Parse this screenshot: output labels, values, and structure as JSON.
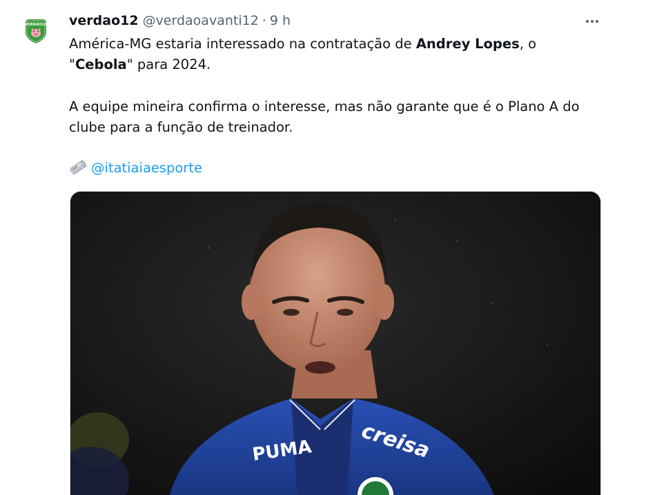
{
  "tweet": {
    "avatar_text": "VERDÃO12",
    "author_name": "verdao12",
    "author_handle": "@verdaoavanti12",
    "separator": "·",
    "timestamp": "9 h",
    "more_icon": "more-horizontal-icon",
    "body": {
      "line1_pre": "América-MG estaria interessado na contratação de ",
      "line1_bold": "Andrey Lopes",
      "line1_post": ", o",
      "line2_quote_open": "\"",
      "line2_bold": "Cebola",
      "line2_post": "\" para 2024.",
      "line3": "A equipe mineira confirma o interesse, mas não garante que é o Plano A do",
      "line4": "clube para a função de treinador.",
      "source_icon": "newspaper-icon",
      "source_mention": "@itatiaiaesporte"
    },
    "media": {
      "alt": "photo",
      "jacket_sponsor": "creisa",
      "jacket_brand": "PUMA"
    }
  },
  "colors": {
    "text": "#0f1419",
    "muted": "#536471",
    "link": "#1d9bf0",
    "avatar_green": "#3a9a3a",
    "jacket_blue": "#1d3d8f"
  }
}
